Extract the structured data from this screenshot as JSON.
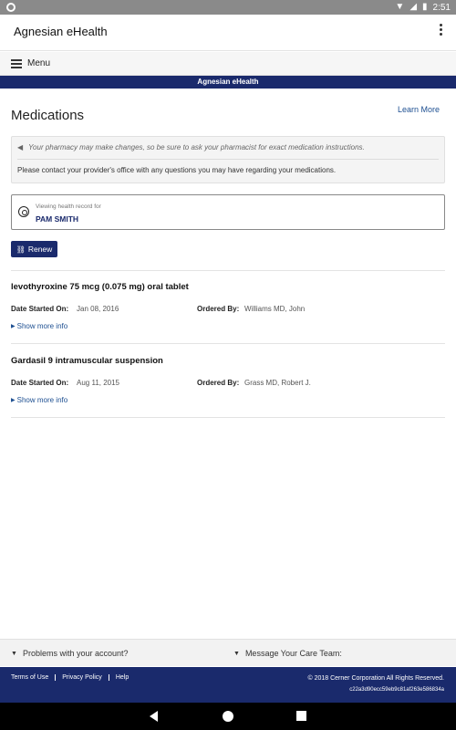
{
  "statusbar": {
    "time": "2:51"
  },
  "appbar": {
    "title": "Agnesian eHealth"
  },
  "menubar": {
    "label": "Menu"
  },
  "banner": {
    "text": "Agnesian eHealth"
  },
  "page": {
    "title": "Medications",
    "learn_more": "Learn More"
  },
  "notice": {
    "line1": "Your pharmacy may make changes, so be sure to ask your pharmacist for exact medication instructions.",
    "line2": "Please contact your provider's office with any questions you may have regarding your medications."
  },
  "viewing": {
    "label": "Viewing health record for",
    "name": "PAM SMITH"
  },
  "renew_label": "Renew",
  "field_labels": {
    "date_started": "Date Started On:",
    "ordered_by": "Ordered By:",
    "show_more": "Show more info"
  },
  "medications": [
    {
      "name": "levothyroxine 75 mcg (0.075 mg) oral tablet",
      "date_started": "Jan 08, 2016",
      "ordered_by": "Williams MD, John"
    },
    {
      "name": "Gardasil 9 intramuscular suspension",
      "date_started": "Aug 11, 2015",
      "ordered_by": "Grass MD, Robert J."
    }
  ],
  "bottom_bar": {
    "problems": "Problems with your account?",
    "message": "Message Your Care Team:"
  },
  "footer": {
    "links": [
      "Terms of Use",
      "Privacy Policy",
      "Help"
    ],
    "copyright": "© 2018 Cerner Corporation All Rights Reserved.",
    "hash": "c22a3d90ecc59eb9c81af263e586834a"
  },
  "colors": {
    "brand_navy": "#1a2a6c",
    "link_blue": "#1d4f91"
  }
}
